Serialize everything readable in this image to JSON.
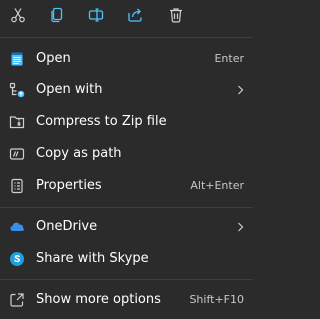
{
  "colors": {
    "background": "#2b2b2b",
    "separator": "#3f3f3f",
    "icon_blue": "#4cc2ff",
    "icon_gray": "#d0d0d0",
    "onedrive_blue": "#3a8ee6",
    "skype_blue": "#1e9ee3",
    "text": "#ffffff",
    "shortcut_text": "#c8c8c8"
  },
  "toolbar": {
    "buttons": [
      {
        "icon": "scissors-icon"
      },
      {
        "icon": "copy-icon"
      },
      {
        "icon": "rename-icon"
      },
      {
        "icon": "share-icon"
      },
      {
        "icon": "trash-icon"
      }
    ]
  },
  "menu": {
    "open": {
      "label": "Open",
      "shortcut": "Enter",
      "icon": "notepad-icon"
    },
    "open_with": {
      "label": "Open with",
      "icon": "open-with-icon"
    },
    "compress": {
      "label": "Compress to Zip file",
      "icon": "zip-folder-icon"
    },
    "copy_path": {
      "label": "Copy as path",
      "icon": "copy-path-icon"
    },
    "properties": {
      "label": "Properties",
      "shortcut": "Alt+Enter",
      "icon": "properties-icon"
    },
    "onedrive": {
      "label": "OneDrive",
      "icon": "onedrive-cloud-icon"
    },
    "skype": {
      "label": "Share with Skype",
      "icon": "skype-icon"
    },
    "more": {
      "label": "Show more options",
      "shortcut": "Shift+F10",
      "icon": "show-more-icon"
    }
  }
}
